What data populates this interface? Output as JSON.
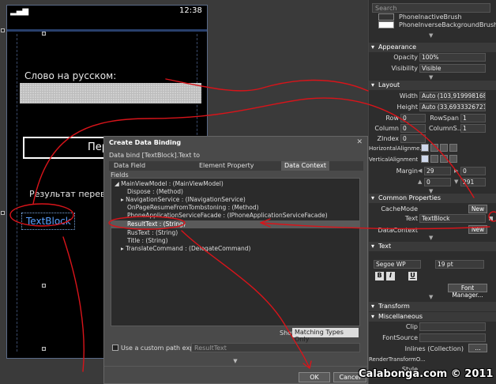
{
  "phone": {
    "time": "12:38",
    "signal": "▂▄▆",
    "label_russian": "Слово на русском:",
    "translate_button": "Пере",
    "result_label": "Результат перевода",
    "textblock": "TextBlock"
  },
  "dialog": {
    "title": "Create Data Binding",
    "close": "✕",
    "subtitle": "Data bind [TextBlock].Text to",
    "tabs": [
      {
        "label": "Data Field"
      },
      {
        "label": "Element Property"
      },
      {
        "label": "Data Context"
      }
    ],
    "fields_label": "Fields",
    "tree": [
      {
        "text": "◢ MainViewModel : (MainViewModel)"
      },
      {
        "text": "Dispose : (Method)"
      },
      {
        "text": "▸ NavigationService : (INavigationService)"
      },
      {
        "text": "OnPageResumeFromTombstoning : (Method)"
      },
      {
        "text": "PhoneApplicationServiceFacade : (IPhoneApplicationServiceFacade)"
      },
      {
        "text": "ResultText : (String)"
      },
      {
        "text": "RusText : (String)"
      },
      {
        "text": "Title : (String)"
      },
      {
        "text": "▸ TranslateCommand : (DelegateCommand)"
      }
    ],
    "show_label": "Show",
    "show_value": "Matching Types Only",
    "custom_path_label": "Use a custom path expression",
    "custom_path_value": "ResultText",
    "ok": "OK",
    "cancel": "Cancel"
  },
  "props": {
    "search_placeholder": "Search",
    "brushes": [
      {
        "name": "PhoneInactiveBrush",
        "color": "#333333"
      },
      {
        "name": "PhoneInverseBackgroundBrush",
        "color": "#ffffff"
      }
    ],
    "appearance": {
      "header": "Appearance",
      "opacity_label": "Opacity",
      "opacity": "100%",
      "visibility_label": "Visibility",
      "visibility": "Visible"
    },
    "layout": {
      "header": "Layout",
      "width_label": "Width",
      "width": "Auto (103,9199981689...",
      "height_label": "Height",
      "height": "Auto (33,6933326721...",
      "row_label": "Row",
      "row": "0",
      "rowspan_label": "RowSpan",
      "rowspan": "1",
      "column_label": "Column",
      "column": "0",
      "columnspan_label": "ColumnS...",
      "columnspan": "1",
      "zindex_label": "ZIndex",
      "zindex": "0",
      "halign_label": "HorizontalAlignme...",
      "valign_label": "VerticalAlignment",
      "margin_label": "Margin",
      "margin_left": "29",
      "margin_right": "0",
      "margin_top": "0",
      "margin_bottom": "291"
    },
    "common": {
      "header": "Common Properties",
      "cachemode_label": "CacheMode",
      "cachemode_btn": "New",
      "text_label": "Text",
      "text": "TextBlock",
      "datacontext_label": "DataContext",
      "datacontext_btn": "New"
    },
    "text_section": {
      "header": "Text",
      "font": "Segoe WP",
      "size": "19 pt",
      "bold": "B",
      "italic": "I",
      "underline": "U",
      "font_manager": "Font Manager..."
    },
    "transform": {
      "header": "Transform"
    },
    "misc": {
      "header": "Miscellaneous",
      "clip_label": "Clip",
      "fontsource_label": "FontSource",
      "inlines_label": "Inlines (Collection)",
      "inlines_btn": "...",
      "rto_label": "RenderTransformO...",
      "style_label": "Style"
    }
  },
  "watermark": "Calabonga.com © 2011",
  "colors": {
    "annotation": "#d8141a",
    "accent": "#5aa0ff"
  }
}
